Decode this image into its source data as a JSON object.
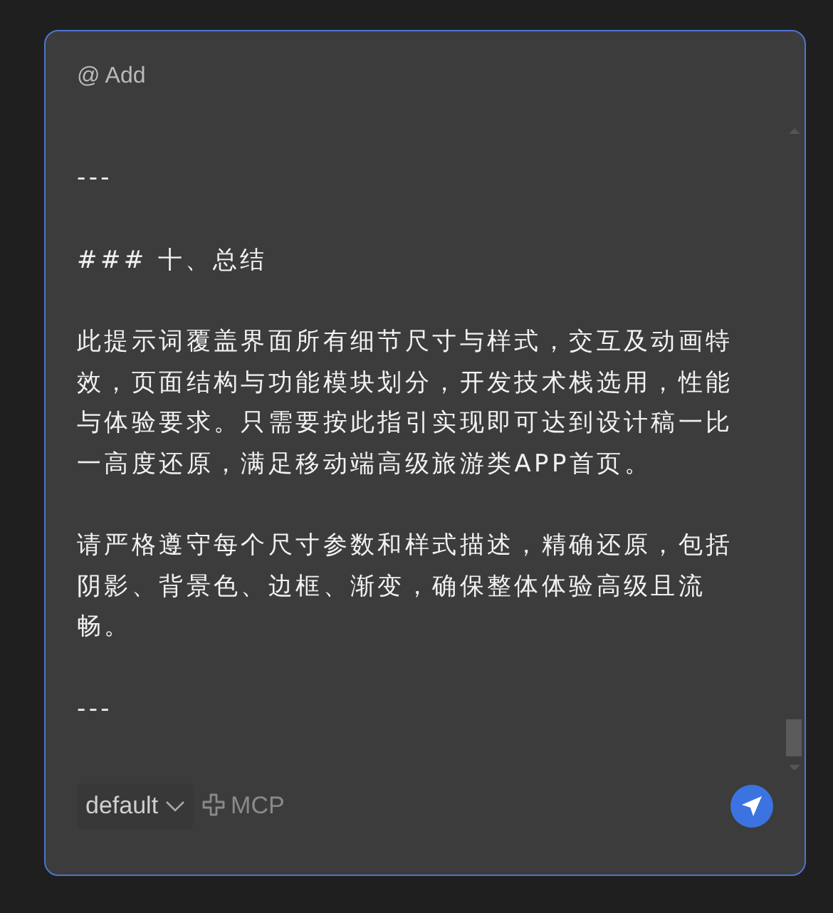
{
  "mention": "@ Add",
  "editor": {
    "paragraphs": [
      "---",
      "### 十、总结",
      "此提示词覆盖界面所有细节尺寸与样式，交互及动画特效，页面结构与功能模块划分，开发技术栈选用，性能与体验要求。只需要按此指引实现即可达到设计稿一比一高度还原，满足移动端高级旅游类APP首页。",
      "请严格遵守每个尺寸参数和样式描述，精确还原，包括阴影、背景色、边框、渐变，确保整体体验高级且流畅。",
      "---"
    ]
  },
  "model_select": {
    "value": "default"
  },
  "mcp": {
    "label": "MCP"
  }
}
